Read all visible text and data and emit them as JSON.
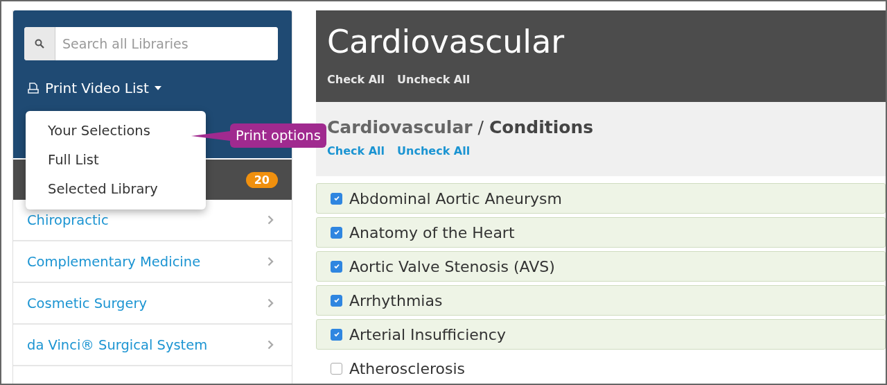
{
  "sidebar": {
    "search": {
      "placeholder": "Search all Libraries"
    },
    "print_button": {
      "label": "Print Video List"
    },
    "print_menu": {
      "items": [
        "Your Selections",
        "Full List",
        "Selected Library"
      ]
    },
    "callout": "Print options",
    "library_header": {
      "badge": "20"
    },
    "libraries": [
      {
        "label": "Chiropractic"
      },
      {
        "label": "Complementary Medicine"
      },
      {
        "label": "Cosmetic Surgery"
      },
      {
        "label": "da Vinci® Surgical System"
      }
    ]
  },
  "main": {
    "title": "Cardiovascular",
    "check_all": "Check All",
    "uncheck_all": "Uncheck All",
    "section": {
      "parent": "Cardiovascular",
      "separator": "/",
      "name": "Conditions",
      "check_all": "Check All",
      "uncheck_all": "Uncheck All"
    },
    "items": [
      {
        "label": "Abdominal Aortic Aneurysm",
        "checked": true
      },
      {
        "label": "Anatomy of the Heart",
        "checked": true
      },
      {
        "label": "Aortic Valve Stenosis (AVS)",
        "checked": true
      },
      {
        "label": "Arrhythmias",
        "checked": true
      },
      {
        "label": "Arterial Insufficiency",
        "checked": true
      },
      {
        "label": "Atherosclerosis",
        "checked": false
      }
    ]
  }
}
